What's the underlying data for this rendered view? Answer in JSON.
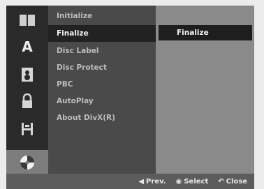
{
  "sidebar": {
    "icons": [
      {
        "name": "disc-menu-icon"
      },
      {
        "name": "language-icon",
        "glyph": "A"
      },
      {
        "name": "audio-icon"
      },
      {
        "name": "lock-icon"
      },
      {
        "name": "recording-icon"
      },
      {
        "name": "disc-icon"
      }
    ]
  },
  "menu": {
    "items": [
      {
        "label": "Initialize"
      },
      {
        "label": "Finalize"
      },
      {
        "label": "Disc Label"
      },
      {
        "label": "Disc Protect"
      },
      {
        "label": "PBC"
      },
      {
        "label": "AutoPlay"
      },
      {
        "label": "About DivX(R)"
      }
    ],
    "selected_index": 1
  },
  "submenu": {
    "option_label": "Finalize"
  },
  "footer": {
    "prev_label": "Prev.",
    "select_label": "Select",
    "close_label": "Close"
  }
}
